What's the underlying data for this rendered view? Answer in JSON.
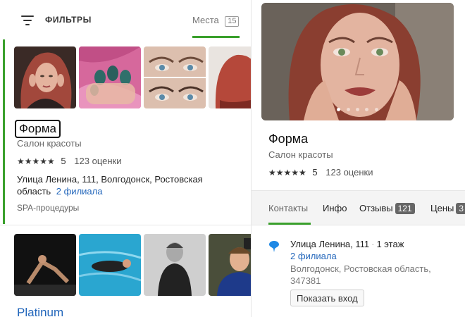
{
  "filters": {
    "label": "ФИЛЬТРЫ",
    "places_label": "Места",
    "places_count": "15"
  },
  "results": [
    {
      "name": "Форма",
      "category": "Салон красоты",
      "stars": "★★★★★",
      "rating": "5",
      "reviews": "123 оценки",
      "address": "Улица Ленина, 111, Волгодонск, Ростовская область",
      "branches": "2 филиала",
      "service": "SPA-процедуры",
      "selected": true
    },
    {
      "name": "Platinum"
    }
  ],
  "detail": {
    "title": "Форма",
    "subtitle": "Салон красоты",
    "stars": "★★★★★",
    "rating": "5",
    "reviews": "123 оценки",
    "gallery_dots": 5,
    "tabs": [
      {
        "label": "Контакты",
        "active": true
      },
      {
        "label": "Инфо"
      },
      {
        "label": "Отзывы",
        "badge": "121"
      },
      {
        "label": "Цены",
        "badge": "3"
      }
    ],
    "address": "Улица Ленина, 111",
    "floor": "1 этаж",
    "branches": "2 филиала",
    "city": "Волгодонск, Ростовская область, 347381",
    "entrance_button": "Показать вход"
  },
  "colors": {
    "accent_green": "#3aa02c",
    "link_blue": "#2266bb",
    "pin_blue": "#1e88e5"
  },
  "icons": {
    "filter": "filter-icon",
    "location": "location-pin-icon"
  }
}
